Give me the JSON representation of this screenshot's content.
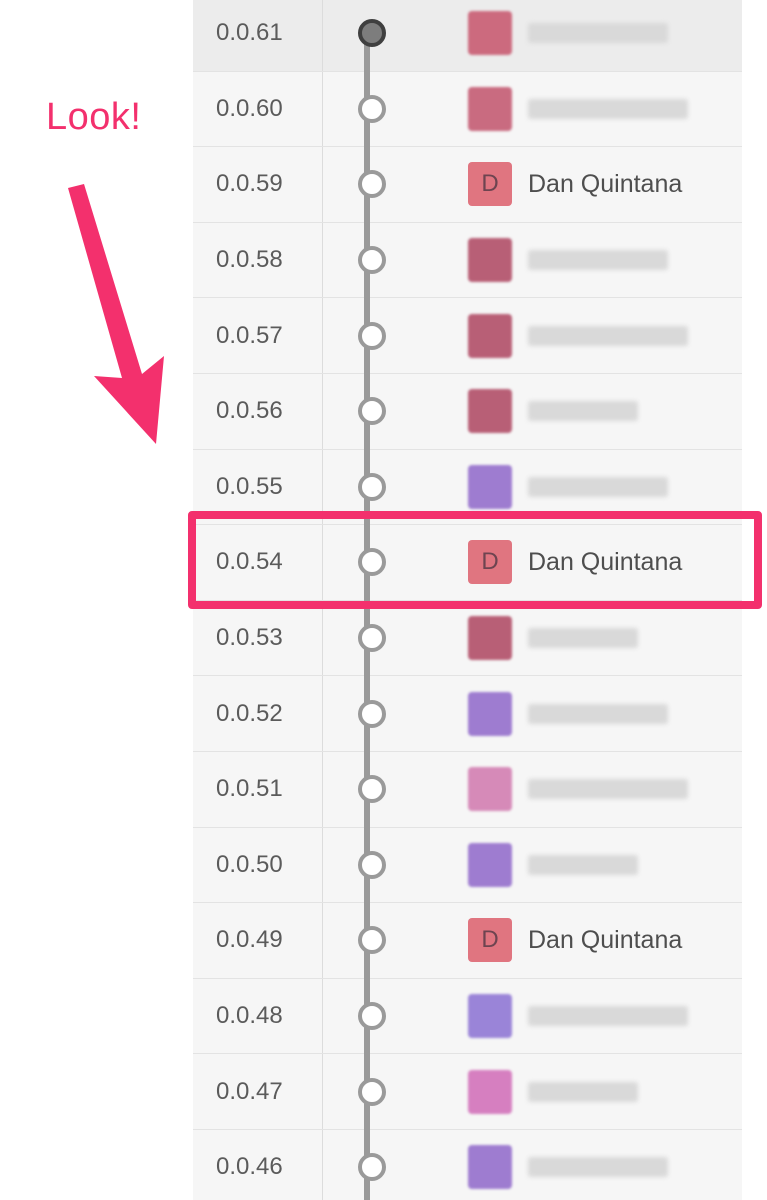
{
  "annotation": {
    "label": "Look!",
    "color": "#f3306d"
  },
  "colors": {
    "panel_bg": "#f6f6f6",
    "row_current_bg": "#ececec",
    "timeline": "#9a9a9a",
    "highlight": "#f3306d"
  },
  "versions": [
    {
      "version": "0.0.61",
      "initial": "",
      "name": "",
      "avatar_color": "#cc6a7e",
      "blurred": true,
      "current": true
    },
    {
      "version": "0.0.60",
      "initial": "",
      "name": "",
      "avatar_color": "#c96b80",
      "blurred": true
    },
    {
      "version": "0.0.59",
      "initial": "D",
      "name": "Dan Quintana",
      "avatar_color": "#e07580",
      "blurred": false
    },
    {
      "version": "0.0.58",
      "initial": "",
      "name": "",
      "avatar_color": "#b85f76",
      "blurred": true
    },
    {
      "version": "0.0.57",
      "initial": "",
      "name": "",
      "avatar_color": "#b85f76",
      "blurred": true
    },
    {
      "version": "0.0.56",
      "initial": "",
      "name": "",
      "avatar_color": "#b85f76",
      "blurred": true
    },
    {
      "version": "0.0.55",
      "initial": "",
      "name": "",
      "avatar_color": "#9e7cd0",
      "blurred": true
    },
    {
      "version": "0.0.54",
      "initial": "D",
      "name": "Dan Quintana",
      "avatar_color": "#e07580",
      "blurred": false,
      "highlighted": true
    },
    {
      "version": "0.0.53",
      "initial": "",
      "name": "",
      "avatar_color": "#b85f76",
      "blurred": true
    },
    {
      "version": "0.0.52",
      "initial": "",
      "name": "",
      "avatar_color": "#9e7cd0",
      "blurred": true
    },
    {
      "version": "0.0.51",
      "initial": "",
      "name": "",
      "avatar_color": "#d68ab8",
      "blurred": true
    },
    {
      "version": "0.0.50",
      "initial": "",
      "name": "",
      "avatar_color": "#9e7cd0",
      "blurred": true
    },
    {
      "version": "0.0.49",
      "initial": "D",
      "name": "Dan Quintana",
      "avatar_color": "#e07580",
      "blurred": false
    },
    {
      "version": "0.0.48",
      "initial": "",
      "name": "",
      "avatar_color": "#9a84d8",
      "blurred": true
    },
    {
      "version": "0.0.47",
      "initial": "",
      "name": "",
      "avatar_color": "#d67fc0",
      "blurred": true
    },
    {
      "version": "0.0.46",
      "initial": "",
      "name": "",
      "avatar_color": "#9e7cd0",
      "blurred": true
    }
  ]
}
